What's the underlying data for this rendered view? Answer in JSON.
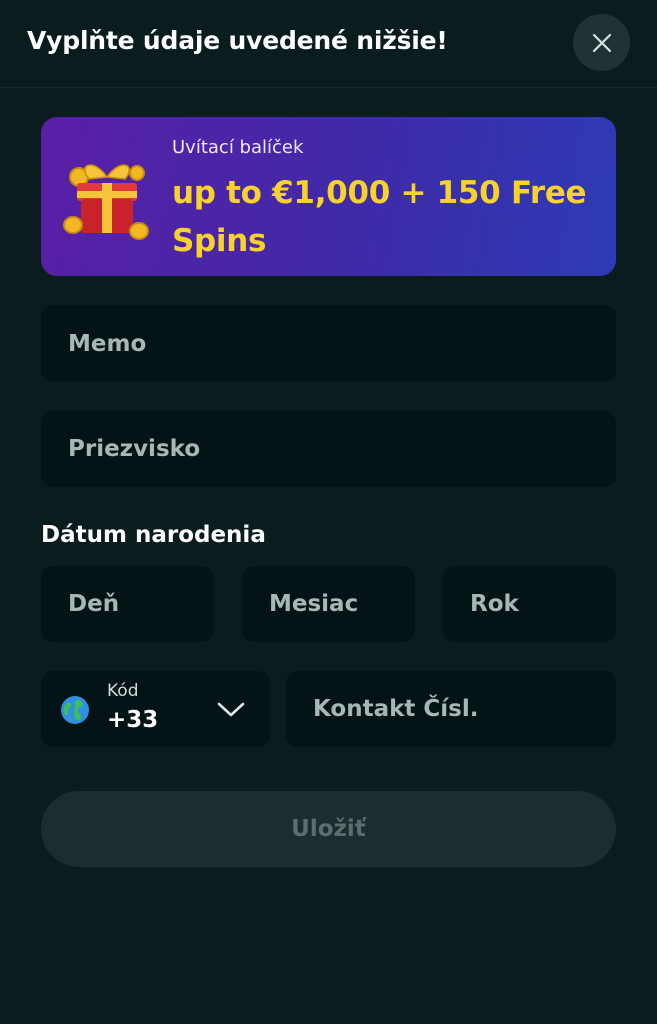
{
  "header": {
    "title": "Vyplňte údaje uvedené nižšie!",
    "close_icon": "close-icon"
  },
  "banner": {
    "label": "Uvítací balíček",
    "offer": "up to €1,000 + 150 Free Spins",
    "icon": "gift-box-icon",
    "accent_color": "#f7d22a"
  },
  "form": {
    "first_name_placeholder": "Memo",
    "last_name_placeholder": "Priezvisko",
    "birth_date": {
      "label": "Dátum narodenia",
      "day_placeholder": "Deň",
      "month_placeholder": "Mesiac",
      "year_placeholder": "Rok"
    },
    "phone": {
      "code_label": "Kód",
      "code_value": "+33",
      "flag_icon": "globe-icon",
      "number_placeholder": "Kontakt Čísl."
    },
    "save_label": "Uložiť"
  }
}
